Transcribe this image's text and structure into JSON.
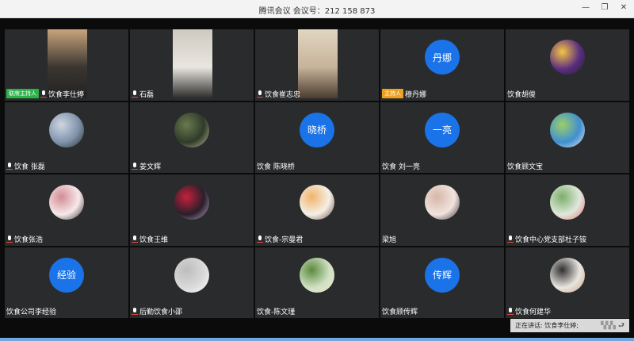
{
  "window": {
    "title": "腾讯会议  会议号：212 158 873"
  },
  "speaking": {
    "label": "正在讲话: 饮食李仕婷;"
  },
  "participants": [
    {
      "name": "饮食李仕婷",
      "badge": "联席主持人",
      "badge_type": "co",
      "mic": true,
      "type": "video",
      "palette": [
        "#3a3530",
        "#c9a47d",
        "#222"
      ]
    },
    {
      "name": "石磊",
      "mic": true,
      "type": "video",
      "palette": [
        "#e8e6df",
        "#cfcac0",
        "#2b2b2b"
      ]
    },
    {
      "name": "饮食崔志忠",
      "mic": true,
      "type": "video",
      "palette": [
        "#c7b29a",
        "#e2d6c2",
        "#4a3b2f"
      ]
    },
    {
      "name": "穆丹娜",
      "badge": "主持人",
      "badge_type": "host",
      "mic": false,
      "type": "text",
      "avatar_text": "丹娜"
    },
    {
      "name": "饮食胡俊",
      "mic": false,
      "type": "image",
      "palette": [
        "#5a2d82",
        "#f5c542",
        "#222"
      ]
    },
    {
      "name": "饮食 张磊",
      "mic": true,
      "type": "image",
      "palette": [
        "#7f93ab",
        "#cfd6e2",
        "#2c2c2c"
      ]
    },
    {
      "name": "姜文辉",
      "mic": true,
      "type": "image",
      "palette": [
        "#2f3b2a",
        "#6b7a4f",
        "#c2b59a"
      ]
    },
    {
      "name": "饮食  陈晓桥",
      "mic": false,
      "type": "text",
      "avatar_text": "晓桥"
    },
    {
      "name": "饮食 刘一亮",
      "mic": false,
      "type": "text",
      "avatar_text": "一亮"
    },
    {
      "name": "饮食顾文宝",
      "mic": false,
      "type": "image",
      "palette": [
        "#3f8fd2",
        "#9ccf6a",
        "#e8e8e8"
      ]
    },
    {
      "name": "饮食张浩",
      "mic": true,
      "type": "image",
      "palette": [
        "#f6e9ea",
        "#d38b95",
        "#3a2c2c"
      ]
    },
    {
      "name": "饮食王维",
      "mic": true,
      "type": "image",
      "palette": [
        "#2a1f2a",
        "#c5203c",
        "#b9a6c7"
      ]
    },
    {
      "name": "饮食-宗曼君",
      "mic": true,
      "type": "image",
      "palette": [
        "#f4f0e8",
        "#f2b36a",
        "#6b4c3b"
      ]
    },
    {
      "name": "梁旭",
      "mic": false,
      "type": "image",
      "palette": [
        "#f1e3df",
        "#d7b7a7",
        "#3d2c2a"
      ]
    },
    {
      "name": "饮食中心党支部杜子铵",
      "mic": true,
      "type": "image",
      "palette": [
        "#dfe8dc",
        "#7cae6a",
        "#e86f7a"
      ]
    },
    {
      "name": "饮食公司李经验",
      "mic": false,
      "type": "text",
      "avatar_text": "经验"
    },
    {
      "name": "后勤饮食小邵",
      "mic": true,
      "type": "image",
      "palette": [
        "#d9d9d9",
        "#bdbdbd",
        "#ffffff"
      ]
    },
    {
      "name": "饮食-陈文瑾",
      "mic": false,
      "type": "image",
      "palette": [
        "#cfe0c2",
        "#5b8a3c",
        "#f3e9d2"
      ]
    },
    {
      "name": "饮食顾传辉",
      "mic": false,
      "type": "text",
      "avatar_text": "传辉"
    },
    {
      "name": "饮食何建华",
      "mic": true,
      "type": "image",
      "palette": [
        "#e9e6e1",
        "#2f2f2f",
        "#c9a27e"
      ]
    }
  ]
}
